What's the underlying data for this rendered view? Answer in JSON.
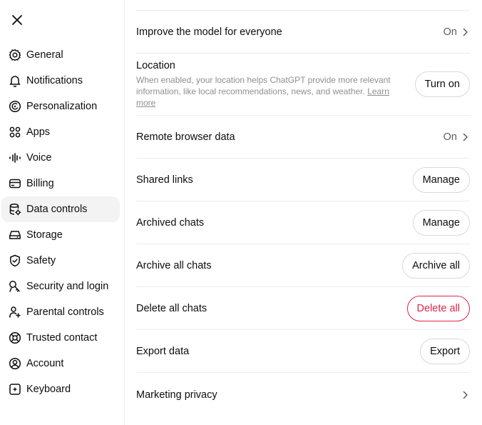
{
  "sidebar": {
    "close_label": "Close",
    "items": [
      {
        "label": "General",
        "icon": "gear-icon"
      },
      {
        "label": "Notifications",
        "icon": "bell-icon"
      },
      {
        "label": "Personalization",
        "icon": "personalization-icon"
      },
      {
        "label": "Apps",
        "icon": "apps-grid-icon"
      },
      {
        "label": "Voice",
        "icon": "voice-wave-icon"
      },
      {
        "label": "Billing",
        "icon": "card-icon"
      },
      {
        "label": "Data controls",
        "icon": "database-gear-icon",
        "active": true
      },
      {
        "label": "Storage",
        "icon": "storage-drive-icon"
      },
      {
        "label": "Safety",
        "icon": "shield-icon"
      },
      {
        "label": "Security and login",
        "icon": "key-icon"
      },
      {
        "label": "Parental controls",
        "icon": "parental-icon"
      },
      {
        "label": "Trusted contact",
        "icon": "lifebuoy-icon"
      },
      {
        "label": "Account",
        "icon": "account-icon"
      },
      {
        "label": "Keyboard",
        "icon": "keyboard-icon"
      }
    ]
  },
  "settings": {
    "improve_model": {
      "label": "Improve the model for everyone",
      "value": "On"
    },
    "location": {
      "title": "Location",
      "description": "When enabled, your location helps ChatGPT provide more relevant information, like local recommendations, news, and weather.",
      "link": "Learn more",
      "button": "Turn on"
    },
    "remote_browser": {
      "label": "Remote browser data",
      "value": "On"
    },
    "shared_links": {
      "label": "Shared links",
      "button": "Manage"
    },
    "archived_chats": {
      "label": "Archived chats",
      "button": "Manage"
    },
    "archive_all": {
      "label": "Archive all chats",
      "button": "Archive all"
    },
    "delete_all": {
      "label": "Delete all chats",
      "button": "Delete all"
    },
    "export_data": {
      "label": "Export data",
      "button": "Export"
    },
    "marketing_privacy": {
      "label": "Marketing privacy"
    }
  },
  "colors": {
    "danger": "#e0244a",
    "active_bg": "#f3f3f3",
    "border": "#ececec"
  }
}
